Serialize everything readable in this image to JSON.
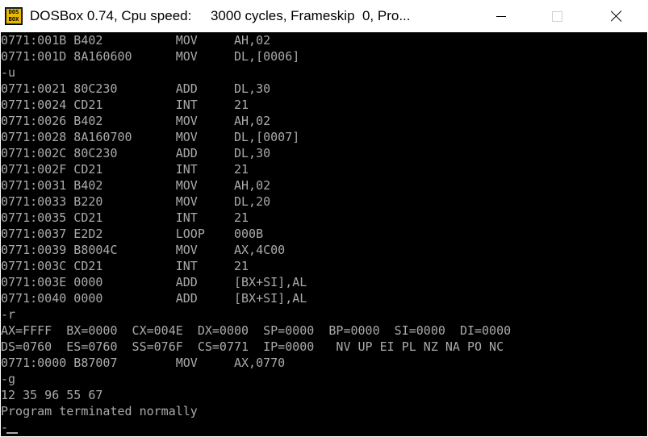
{
  "window": {
    "title": "DOSBox 0.74, Cpu speed:     3000 cycles, Frameskip  0, Pro...",
    "icon_text_top": "DOS",
    "icon_text_bottom": "BOX"
  },
  "colors": {
    "screen_bg": "#000000",
    "text": "#aaaaaa",
    "titlebar_bg": "#ffffff"
  },
  "terminal": {
    "lines": [
      "0771:001B B402          MOV     AH,02",
      "0771:001D 8A160600      MOV     DL,[0006]",
      "-u",
      "0771:0021 80C230        ADD     DL,30",
      "0771:0024 CD21          INT     21",
      "0771:0026 B402          MOV     AH,02",
      "0771:0028 8A160700      MOV     DL,[0007]",
      "0771:002C 80C230        ADD     DL,30",
      "0771:002F CD21          INT     21",
      "0771:0031 B402          MOV     AH,02",
      "0771:0033 B220          MOV     DL,20",
      "0771:0035 CD21          INT     21",
      "0771:0037 E2D2          LOOP    000B",
      "0771:0039 B8004C        MOV     AX,4C00",
      "0771:003C CD21          INT     21",
      "0771:003E 0000          ADD     [BX+SI],AL",
      "0771:0040 0000          ADD     [BX+SI],AL",
      "-r",
      "AX=FFFF  BX=0000  CX=004E  DX=0000  SP=0000  BP=0000  SI=0000  DI=0000",
      "DS=0760  ES=0760  SS=076F  CS=0771  IP=0000   NV UP EI PL NZ NA PO NC",
      "0771:0000 B87007        MOV     AX,0770",
      "-g",
      "12 35 96 55 67",
      "Program terminated normally",
      "-"
    ]
  }
}
